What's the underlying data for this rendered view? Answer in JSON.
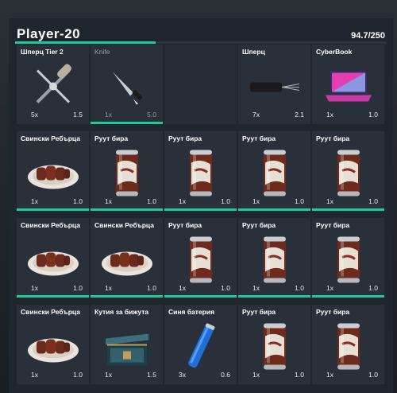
{
  "inventory": {
    "title": "Player-20",
    "weight_text": "94.7/250",
    "weight_fraction": 0.379,
    "accent_color": "#1ecba0"
  },
  "slots": [
    {
      "name": "Шперц Tier 2",
      "qty": "5x",
      "weight": "1.5",
      "icon": "lockpick-icon",
      "bar": false,
      "dim": false
    },
    {
      "name": "Knife",
      "qty": "1x",
      "weight": "5.0",
      "icon": "knife-icon",
      "bar": true,
      "dim": true
    },
    {
      "name": "",
      "qty": "",
      "weight": "",
      "icon": "",
      "bar": false,
      "dim": false,
      "empty": true
    },
    {
      "name": "Шперц",
      "qty": "7x",
      "weight": "2.1",
      "icon": "lockpick-tool-icon",
      "bar": false,
      "dim": false
    },
    {
      "name": "CyberBook",
      "qty": "1x",
      "weight": "1.0",
      "icon": "laptop-icon",
      "bar": false,
      "dim": false
    },
    {
      "name": "Свински Ребърца",
      "qty": "1x",
      "weight": "1.0",
      "icon": "ribs-icon",
      "bar": true,
      "dim": false
    },
    {
      "name": "Руут бира",
      "qty": "1x",
      "weight": "1.0",
      "icon": "rootbeer-can-icon",
      "bar": true,
      "dim": false
    },
    {
      "name": "Руут бира",
      "qty": "1x",
      "weight": "1.0",
      "icon": "rootbeer-can-icon",
      "bar": true,
      "dim": false
    },
    {
      "name": "Руут бира",
      "qty": "1x",
      "weight": "1.0",
      "icon": "rootbeer-can-icon",
      "bar": true,
      "dim": false
    },
    {
      "name": "Руут бира",
      "qty": "1x",
      "weight": "1.0",
      "icon": "rootbeer-can-icon",
      "bar": true,
      "dim": false
    },
    {
      "name": "Свински Ребърца",
      "qty": "1x",
      "weight": "1.0",
      "icon": "ribs-icon",
      "bar": true,
      "dim": false
    },
    {
      "name": "Свински Ребърца",
      "qty": "1x",
      "weight": "1.0",
      "icon": "ribs-icon",
      "bar": true,
      "dim": false
    },
    {
      "name": "Руут бира",
      "qty": "1x",
      "weight": "1.0",
      "icon": "rootbeer-can-icon",
      "bar": true,
      "dim": false
    },
    {
      "name": "Руут бира",
      "qty": "1x",
      "weight": "1.0",
      "icon": "rootbeer-can-icon",
      "bar": true,
      "dim": false
    },
    {
      "name": "Руут бира",
      "qty": "1x",
      "weight": "1.0",
      "icon": "rootbeer-can-icon",
      "bar": true,
      "dim": false
    },
    {
      "name": "Свински Ребърца",
      "qty": "1x",
      "weight": "1.0",
      "icon": "ribs-icon",
      "bar": false,
      "dim": false
    },
    {
      "name": "Кутия за бижута",
      "qty": "1x",
      "weight": "1.5",
      "icon": "jewelry-box-icon",
      "bar": false,
      "dim": false
    },
    {
      "name": "Синя батерия",
      "qty": "3x",
      "weight": "0.6",
      "icon": "blue-battery-icon",
      "bar": false,
      "dim": false
    },
    {
      "name": "Руут бира",
      "qty": "1x",
      "weight": "1.0",
      "icon": "rootbeer-can-icon",
      "bar": false,
      "dim": false
    },
    {
      "name": "Руут бира",
      "qty": "1x",
      "weight": "1.0",
      "icon": "rootbeer-can-icon",
      "bar": false,
      "dim": false
    }
  ]
}
